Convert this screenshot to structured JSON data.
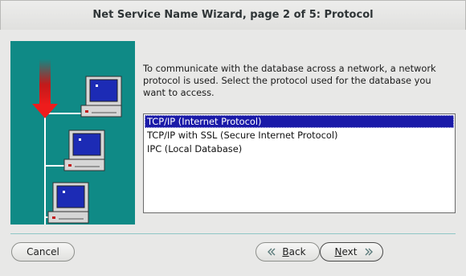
{
  "window": {
    "title": "Net Service Name Wizard, page 2 of 5: Protocol"
  },
  "prompt": "To communicate with the database across a network, a network protocol is used.  Select the protocol used for the database you want to access.",
  "protocols": {
    "selected_index": 0,
    "items": [
      "TCP/IP (Internet Protocol)",
      "TCP/IP with SSL (Secure Internet Protocol)",
      "IPC (Local Database)"
    ]
  },
  "buttons": {
    "cancel": "Cancel",
    "back_mnemonic": "B",
    "back_rest": "ack",
    "next_mnemonic": "N",
    "next_rest": "ext"
  },
  "colors": {
    "illustration_bg": "#0f8a86",
    "selection": "#1a1aa8",
    "arrow": "#e02020"
  }
}
